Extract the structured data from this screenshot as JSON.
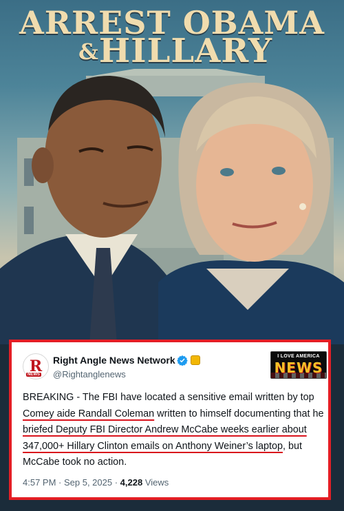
{
  "poster": {
    "title_line1": "ARREST OBAMA",
    "title_amp": "&",
    "title_line2": "HILLARY"
  },
  "tweet": {
    "account_name": "Right Angle News Network",
    "handle": "@Rightanglenews",
    "avatar_letter": "R",
    "avatar_tag": "NEWS",
    "logo_top": "I LOVE AMERICA",
    "logo_bottom": "NEWS",
    "text": {
      "p1": "BREAKING - The FBI have located a sensitive email written by top ",
      "p2": "Comey aide Randall Coleman",
      "p3": " written to himself documenting that he ",
      "p4": "briefed Deputy FBI Director Andrew McCabe weeks earlier about 347,000+ Hillary Clinton emails on Anthony Weiner’s laptop",
      "p5": ", but McCabe took no action."
    },
    "time": "4:57 PM",
    "dot1": " · ",
    "date": "Sep 5, 2025",
    "dot2": " · ",
    "views_count": "4,228",
    "views_label": " Views"
  },
  "colors": {
    "border_red": "#e41e25",
    "verified_blue": "#1d9bf0",
    "affiliate_gold": "#f2b705"
  }
}
